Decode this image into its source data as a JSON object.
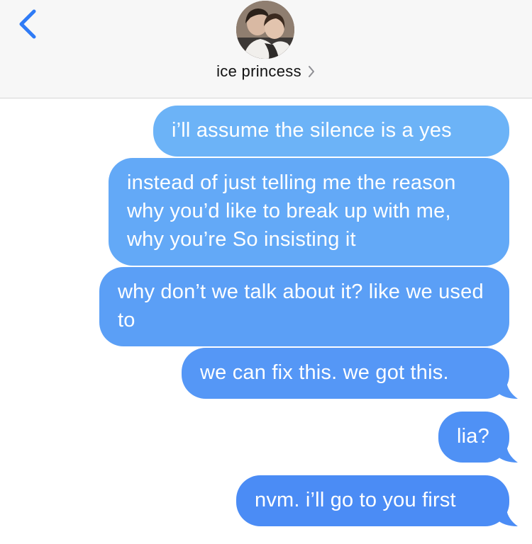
{
  "header": {
    "contact_name": "ice princess",
    "icons": {
      "back": "chevron-left-icon",
      "details": "chevron-right-icon"
    },
    "accent_color": "#2f7bf6"
  },
  "messages": [
    {
      "text": "i’ll assume the silence is a yes",
      "sender": "me",
      "color": "#6cb3f7"
    },
    {
      "text": "instead of just telling me the reason why you’d like to break up with me, why you’re So insisting it",
      "sender": "me",
      "color": "#63a9f7"
    },
    {
      "text": "why don’t we talk about it? like we used to",
      "sender": "me",
      "color": "#5b9ff6"
    },
    {
      "text": "we can fix this. we got this.",
      "sender": "me",
      "color": "#5597f6"
    },
    {
      "text": "lia?",
      "sender": "me",
      "color": "#4f91f5"
    },
    {
      "text": "nvm. i’ll go to you first",
      "sender": "me",
      "color": "#4b8cf5"
    }
  ]
}
